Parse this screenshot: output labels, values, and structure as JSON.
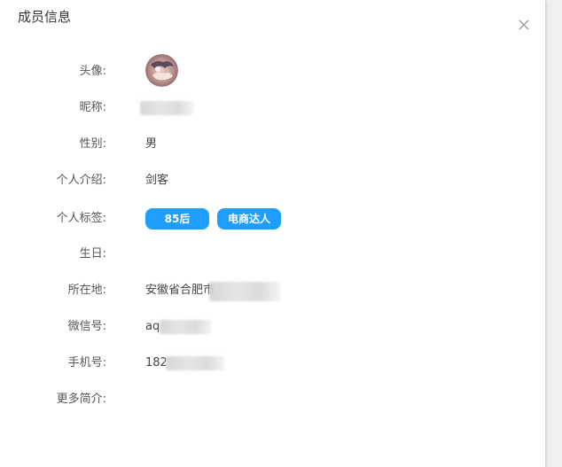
{
  "dialog": {
    "title": "成员信息",
    "close_icon": "close-icon"
  },
  "profile": {
    "avatar_label": "头像:",
    "nickname_label": "昵称:",
    "nickname_value": "",
    "gender_label": "性别:",
    "gender_value": "男",
    "intro_label": "个人介绍:",
    "intro_value": "剑客",
    "tags_label": "个人标签:",
    "tags": [
      "85后",
      "电商达人"
    ],
    "birthday_label": "生日:",
    "birthday_value": "",
    "location_label": "所在地:",
    "location_value": "安徽省合肥市",
    "wechat_label": "微信号:",
    "wechat_value": "aq",
    "phone_label": "手机号:",
    "phone_value": "182",
    "more_label": "更多简介:",
    "more_value": ""
  },
  "colors": {
    "tag_bg": "#1e9fff",
    "tag_text": "#ffffff",
    "label_text": "#555555",
    "value_text": "#444444"
  }
}
